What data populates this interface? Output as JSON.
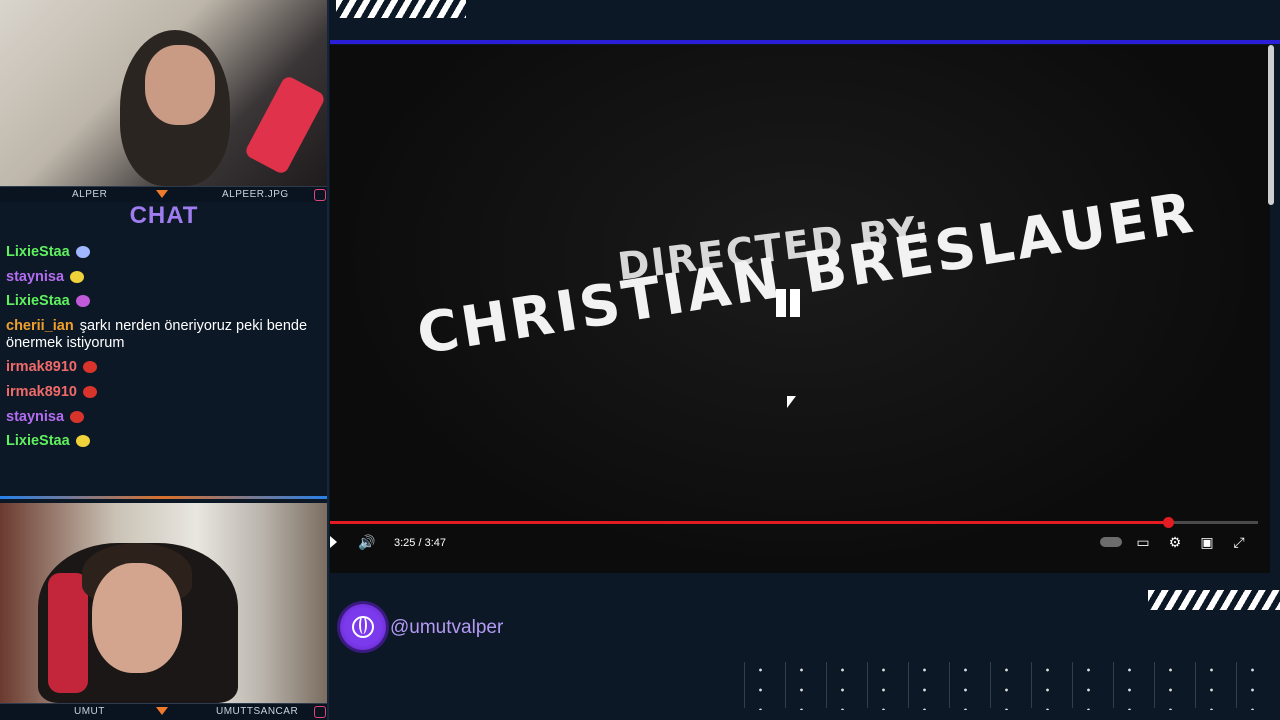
{
  "streamers": {
    "top": {
      "name": "ALPER",
      "handle_tag": "ALPEER.JPG"
    },
    "bottom": {
      "name": "UMUT",
      "handle_tag": "UMUTTSANCAR"
    }
  },
  "chat": {
    "title": "CHAT",
    "messages": [
      {
        "user": "LixieStaa",
        "user_color": "#5ef05e",
        "text": "",
        "emote_color": "#a0b8ff"
      },
      {
        "user": "staynisa",
        "user_color": "#b36cf0",
        "text": "",
        "emote_color": "#f0d23a"
      },
      {
        "user": "LixieStaa",
        "user_color": "#5ef05e",
        "text": "",
        "emote_color": "#c05ad8"
      },
      {
        "user": "cherii_ian",
        "user_color": "#f0a02a",
        "text": "şarkı nerden öneriyoruz peki bende önermek istiyorum",
        "emote_color": ""
      },
      {
        "user": "irmak8910",
        "user_color": "#f06a6a",
        "text": "",
        "emote_color": "#d8342c"
      },
      {
        "user": "irmak8910",
        "user_color": "#f06a6a",
        "text": "",
        "emote_color": "#d8342c"
      },
      {
        "user": "staynisa",
        "user_color": "#b36cf0",
        "text": "",
        "emote_color": "#d8342c"
      },
      {
        "user": "LixieStaa",
        "user_color": "#5ef05e",
        "text": "",
        "emote_color": "#f0d23a"
      }
    ]
  },
  "video": {
    "directed_label": "DIRECTED BY:",
    "director_name": "CHRISTIAN BRESLAUER",
    "time": "3:25 / 3:47",
    "progress": 0.903,
    "icons": [
      "play-icon",
      "volume-icon",
      "autoplay-toggle",
      "subtitles-icon",
      "settings-icon",
      "theater-icon",
      "fullscreen-icon"
    ]
  },
  "social": {
    "handle": "@umutvalper"
  },
  "colors": {
    "accent": "#7c3aed",
    "progress": "#e31b23",
    "chat_title": "#9f7cf0"
  }
}
